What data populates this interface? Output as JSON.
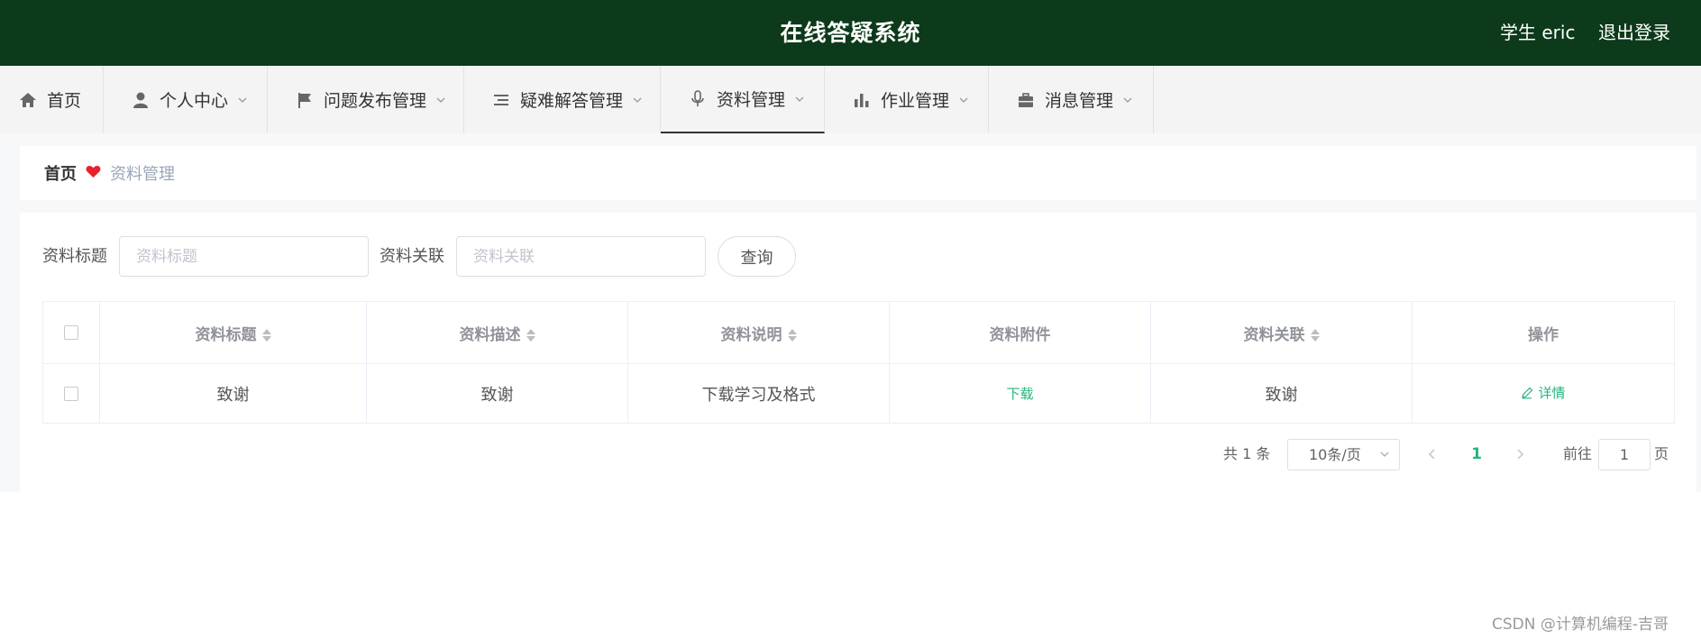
{
  "header": {
    "title": "在线答疑系统",
    "user": "学生 eric",
    "logout": "退出登录"
  },
  "nav": [
    {
      "label": "首页",
      "icon": "home-icon"
    },
    {
      "label": "个人中心",
      "icon": "user-icon"
    },
    {
      "label": "问题发布管理",
      "icon": "flag-icon"
    },
    {
      "label": "疑难解答管理",
      "icon": "list-icon"
    },
    {
      "label": "资料管理",
      "icon": "microphone-icon",
      "active": true
    },
    {
      "label": "作业管理",
      "icon": "bar-chart-icon"
    },
    {
      "label": "消息管理",
      "icon": "briefcase-icon"
    }
  ],
  "breadcrumb": {
    "home": "首页",
    "current": "资料管理"
  },
  "search": {
    "title_label": "资料标题",
    "title_placeholder": "资料标题",
    "relation_label": "资料关联",
    "relation_placeholder": "资料关联",
    "query_button": "查询"
  },
  "table": {
    "columns": [
      "资料标题",
      "资料描述",
      "资料说明",
      "资料附件",
      "资料关联",
      "操作"
    ],
    "rows": [
      {
        "title": "致谢",
        "description": "致谢",
        "explanation": "下载学习及格式",
        "attachment": "下载",
        "relation": "致谢",
        "action": "详情"
      }
    ]
  },
  "pagination": {
    "total": "共 1 条",
    "page_size": "10条/页",
    "current_page": "1",
    "goto_prefix": "前往",
    "goto_value": "1",
    "goto_suffix": "页"
  },
  "watermark": "CSDN @计算机编程-吉哥",
  "colors": {
    "header_bg": "#0c3a1a",
    "accent_green": "#26b57c",
    "heart": "#e8212b"
  }
}
